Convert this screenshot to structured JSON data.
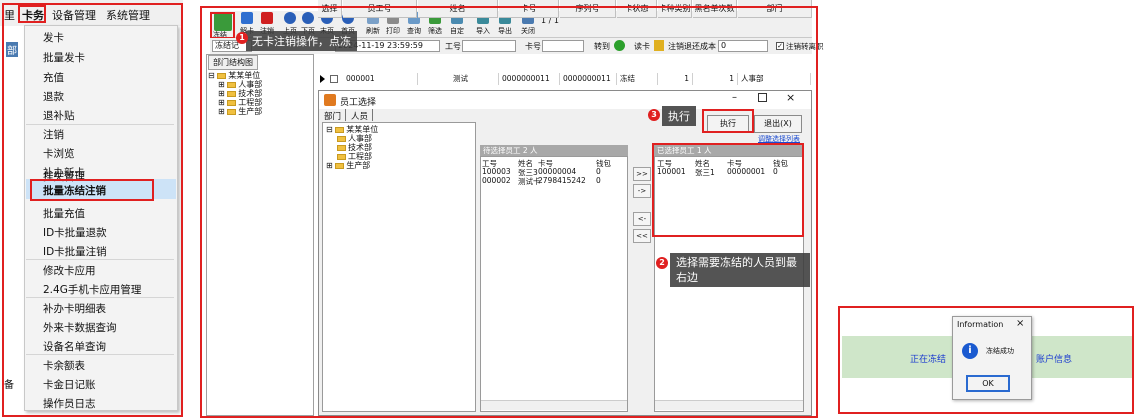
{
  "menu": {
    "bar": [
      "卡务",
      "设备管理",
      "系统管理"
    ],
    "bar_prefix": "里",
    "items": [
      "发卡",
      "批量发卡",
      "充值",
      "退款",
      "退补贴",
      "注销",
      "卡浏览",
      "补办新卡",
      "挂失管理",
      "批量冻结注销",
      "批量充值",
      "ID卡批量退款",
      "ID卡批量注销",
      "修改卡应用",
      "2.4G手机卡应用管理",
      "补办卡明细表",
      "外来卡数据查询",
      "设备名单查询",
      "卡余额表",
      "卡金日记账",
      "操作员日志"
    ],
    "highlighted": "批量冻结注销",
    "left_edge_marks": [
      "部",
      "备"
    ]
  },
  "toolbar": {
    "buttons": [
      "冻结",
      "解卡",
      "注销",
      "上页",
      "下页",
      "末页",
      "首页",
      "刷新",
      "打印",
      "查询",
      "筛选",
      "自定",
      "导入",
      "导出",
      "关闭"
    ],
    "counter": "1 / 1",
    "accent": "#e02020"
  },
  "callouts": {
    "c1": {
      "badge": "1",
      "text": "无卡注销操作，点冻"
    },
    "c2": {
      "badge": "2",
      "text": "选择需要冻结的人员到最右边"
    },
    "c3": {
      "badge": "3",
      "text": "执行"
    }
  },
  "filter": {
    "prefix": "冻结记",
    "date": "2024-11-19 23:59:59",
    "gong_label": "工号",
    "card_label": "卡号",
    "goto_label": "转到",
    "read_label": "读卡",
    "cost_label": "注销退还成本",
    "cost_value": "0",
    "checkbox_label": "注销转离职"
  },
  "tree": {
    "tab": "部门结构图",
    "root": "某某单位",
    "nodes": [
      "人事部",
      "技术部",
      "工程部",
      "生产部"
    ]
  },
  "grid": {
    "headers": [
      "选择",
      "员工号",
      "姓名",
      "卡号",
      "序列号",
      "卡状态",
      "卡种类别",
      "黑名单次数",
      "部门"
    ],
    "row": [
      "",
      "000001",
      "测试",
      "0000000011",
      "0000000011",
      "冻结",
      "1",
      "1",
      "人事部"
    ]
  },
  "dialog": {
    "title": "员工选择",
    "tabs": [
      "部门",
      "人员"
    ],
    "tree_root": "某某单位",
    "tree_nodes": [
      "人事部",
      "技术部",
      "工程部",
      "生产部"
    ],
    "execute": "执行",
    "exit": "退出(X)",
    "adjust_link": "调整选择列表",
    "pending_header": "待选择员工 2 人",
    "selected_header": "已选择员工 1 人",
    "cols": [
      "工号",
      "姓名",
      "卡号",
      "钱包"
    ],
    "pending_rows": [
      [
        "100003",
        "张三3",
        "00000004",
        "0"
      ],
      [
        "000002",
        "测试卡",
        "2798415242",
        "0"
      ]
    ],
    "selected_rows": [
      [
        "100001",
        "张三1",
        "00000001",
        "0"
      ]
    ],
    "move_buttons": [
      ">>",
      "->",
      "<-",
      "<<"
    ]
  },
  "info_dialog": {
    "title": "Information",
    "message": "冻结成功",
    "ok": "OK",
    "bg_left": "正在冻结",
    "bg_right": "账户信息"
  }
}
